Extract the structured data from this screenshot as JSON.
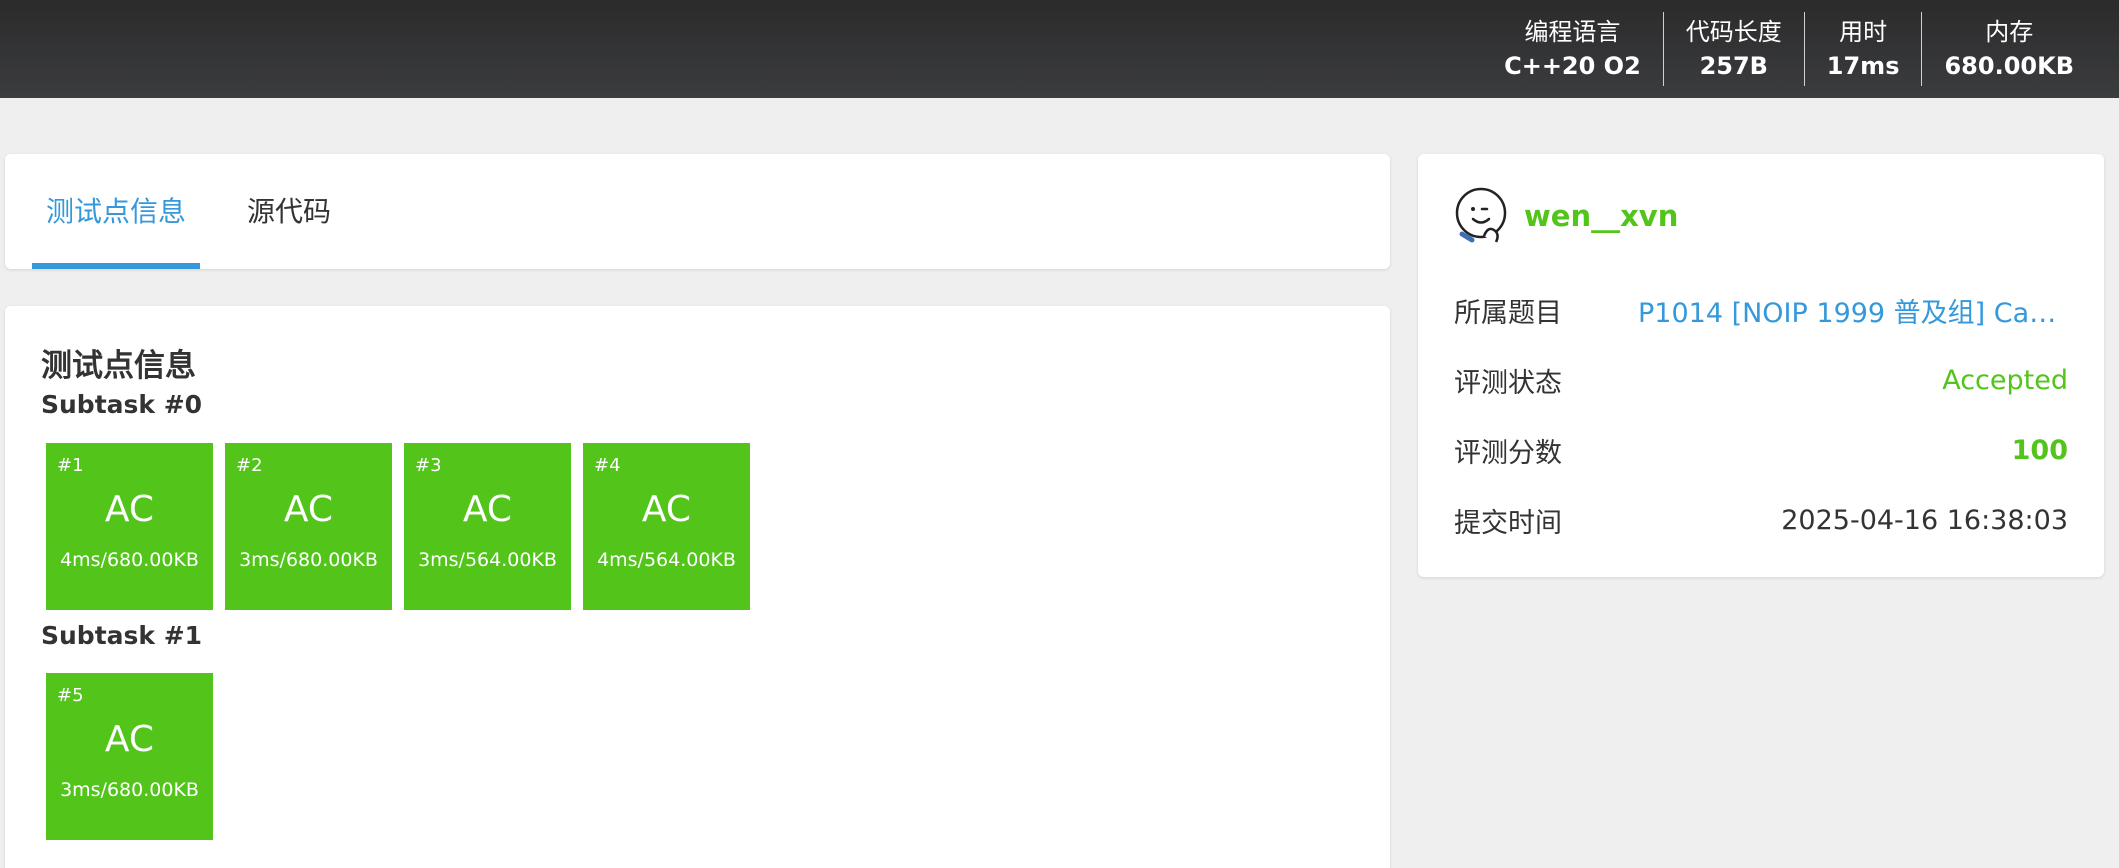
{
  "header": {
    "stats": [
      {
        "label": "编程语言",
        "value": "C++20 O2"
      },
      {
        "label": "代码长度",
        "value": "257B"
      },
      {
        "label": "用时",
        "value": "17ms"
      },
      {
        "label": "内存",
        "value": "680.00KB"
      }
    ]
  },
  "tabs": [
    {
      "label": "测试点信息",
      "active": true
    },
    {
      "label": "源代码",
      "active": false
    }
  ],
  "testcases": {
    "title": "测试点信息",
    "subtasks": [
      {
        "name": "Subtask #0",
        "cases": [
          {
            "id": "#1",
            "status": "AC",
            "detail": "4ms/680.00KB"
          },
          {
            "id": "#2",
            "status": "AC",
            "detail": "3ms/680.00KB"
          },
          {
            "id": "#3",
            "status": "AC",
            "detail": "3ms/564.00KB"
          },
          {
            "id": "#4",
            "status": "AC",
            "detail": "4ms/564.00KB"
          }
        ]
      },
      {
        "name": "Subtask #1",
        "cases": [
          {
            "id": "#5",
            "status": "AC",
            "detail": "3ms/680.00KB"
          }
        ]
      }
    ]
  },
  "info": {
    "username": "wen__xvn",
    "avatar_icon": "smiley-waving-avatar-icon",
    "rows": [
      {
        "label": "所属题目",
        "value": "P1014 [NOIP 1999 普及组] Can..."
      },
      {
        "label": "评测状态",
        "value": "Accepted"
      },
      {
        "label": "评测分数",
        "value": "100"
      },
      {
        "label": "提交时间",
        "value": "2025-04-16 16:38:03"
      }
    ]
  },
  "colors": {
    "accent": "#3498db",
    "success": "#52c41a",
    "header_bg": "#343536",
    "page_bg": "#efefef"
  }
}
